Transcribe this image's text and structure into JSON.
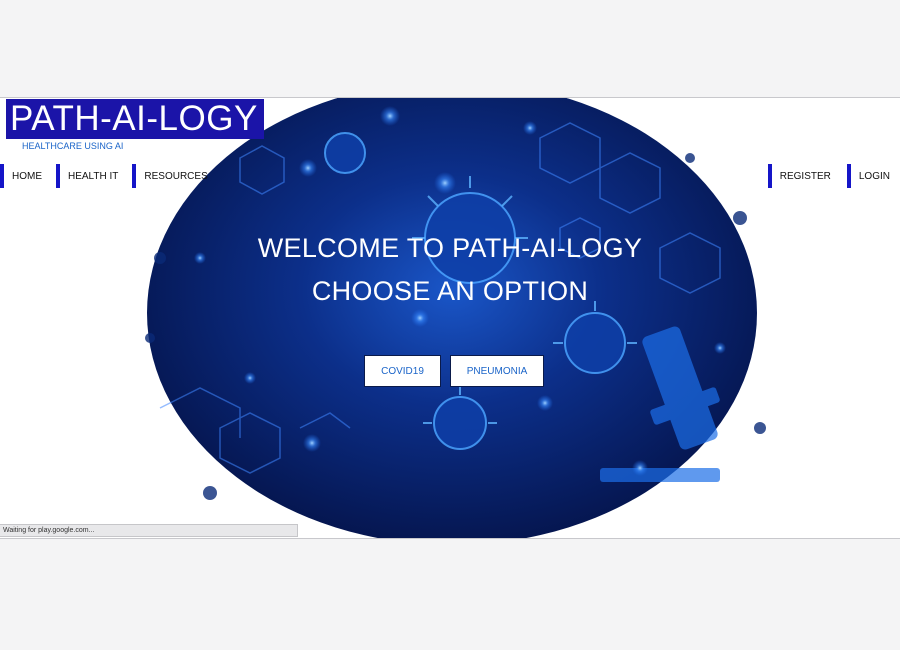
{
  "brand": {
    "title": "PATH-AI-LOGY",
    "tagline": "HEALTHCARE USING AI"
  },
  "nav_left": [
    "HOME",
    "HEALTH IT",
    "RESOURCES"
  ],
  "nav_right": [
    "REGISTER",
    "LOGIN"
  ],
  "hero": {
    "line1": "WELCOME TO PATH-AI-LOGY",
    "line2": "CHOOSE AN OPTION",
    "buttons": [
      "COVID19",
      "PNEUMONIA"
    ]
  },
  "status_bar": "Waiting for play.google.com...",
  "colors": {
    "brand_blue": "#1b14a8",
    "nav_accent": "#1515c8",
    "button_text": "#1a64c8",
    "hero_dark": "#061a52",
    "hero_glow": "#1f6ff0"
  }
}
